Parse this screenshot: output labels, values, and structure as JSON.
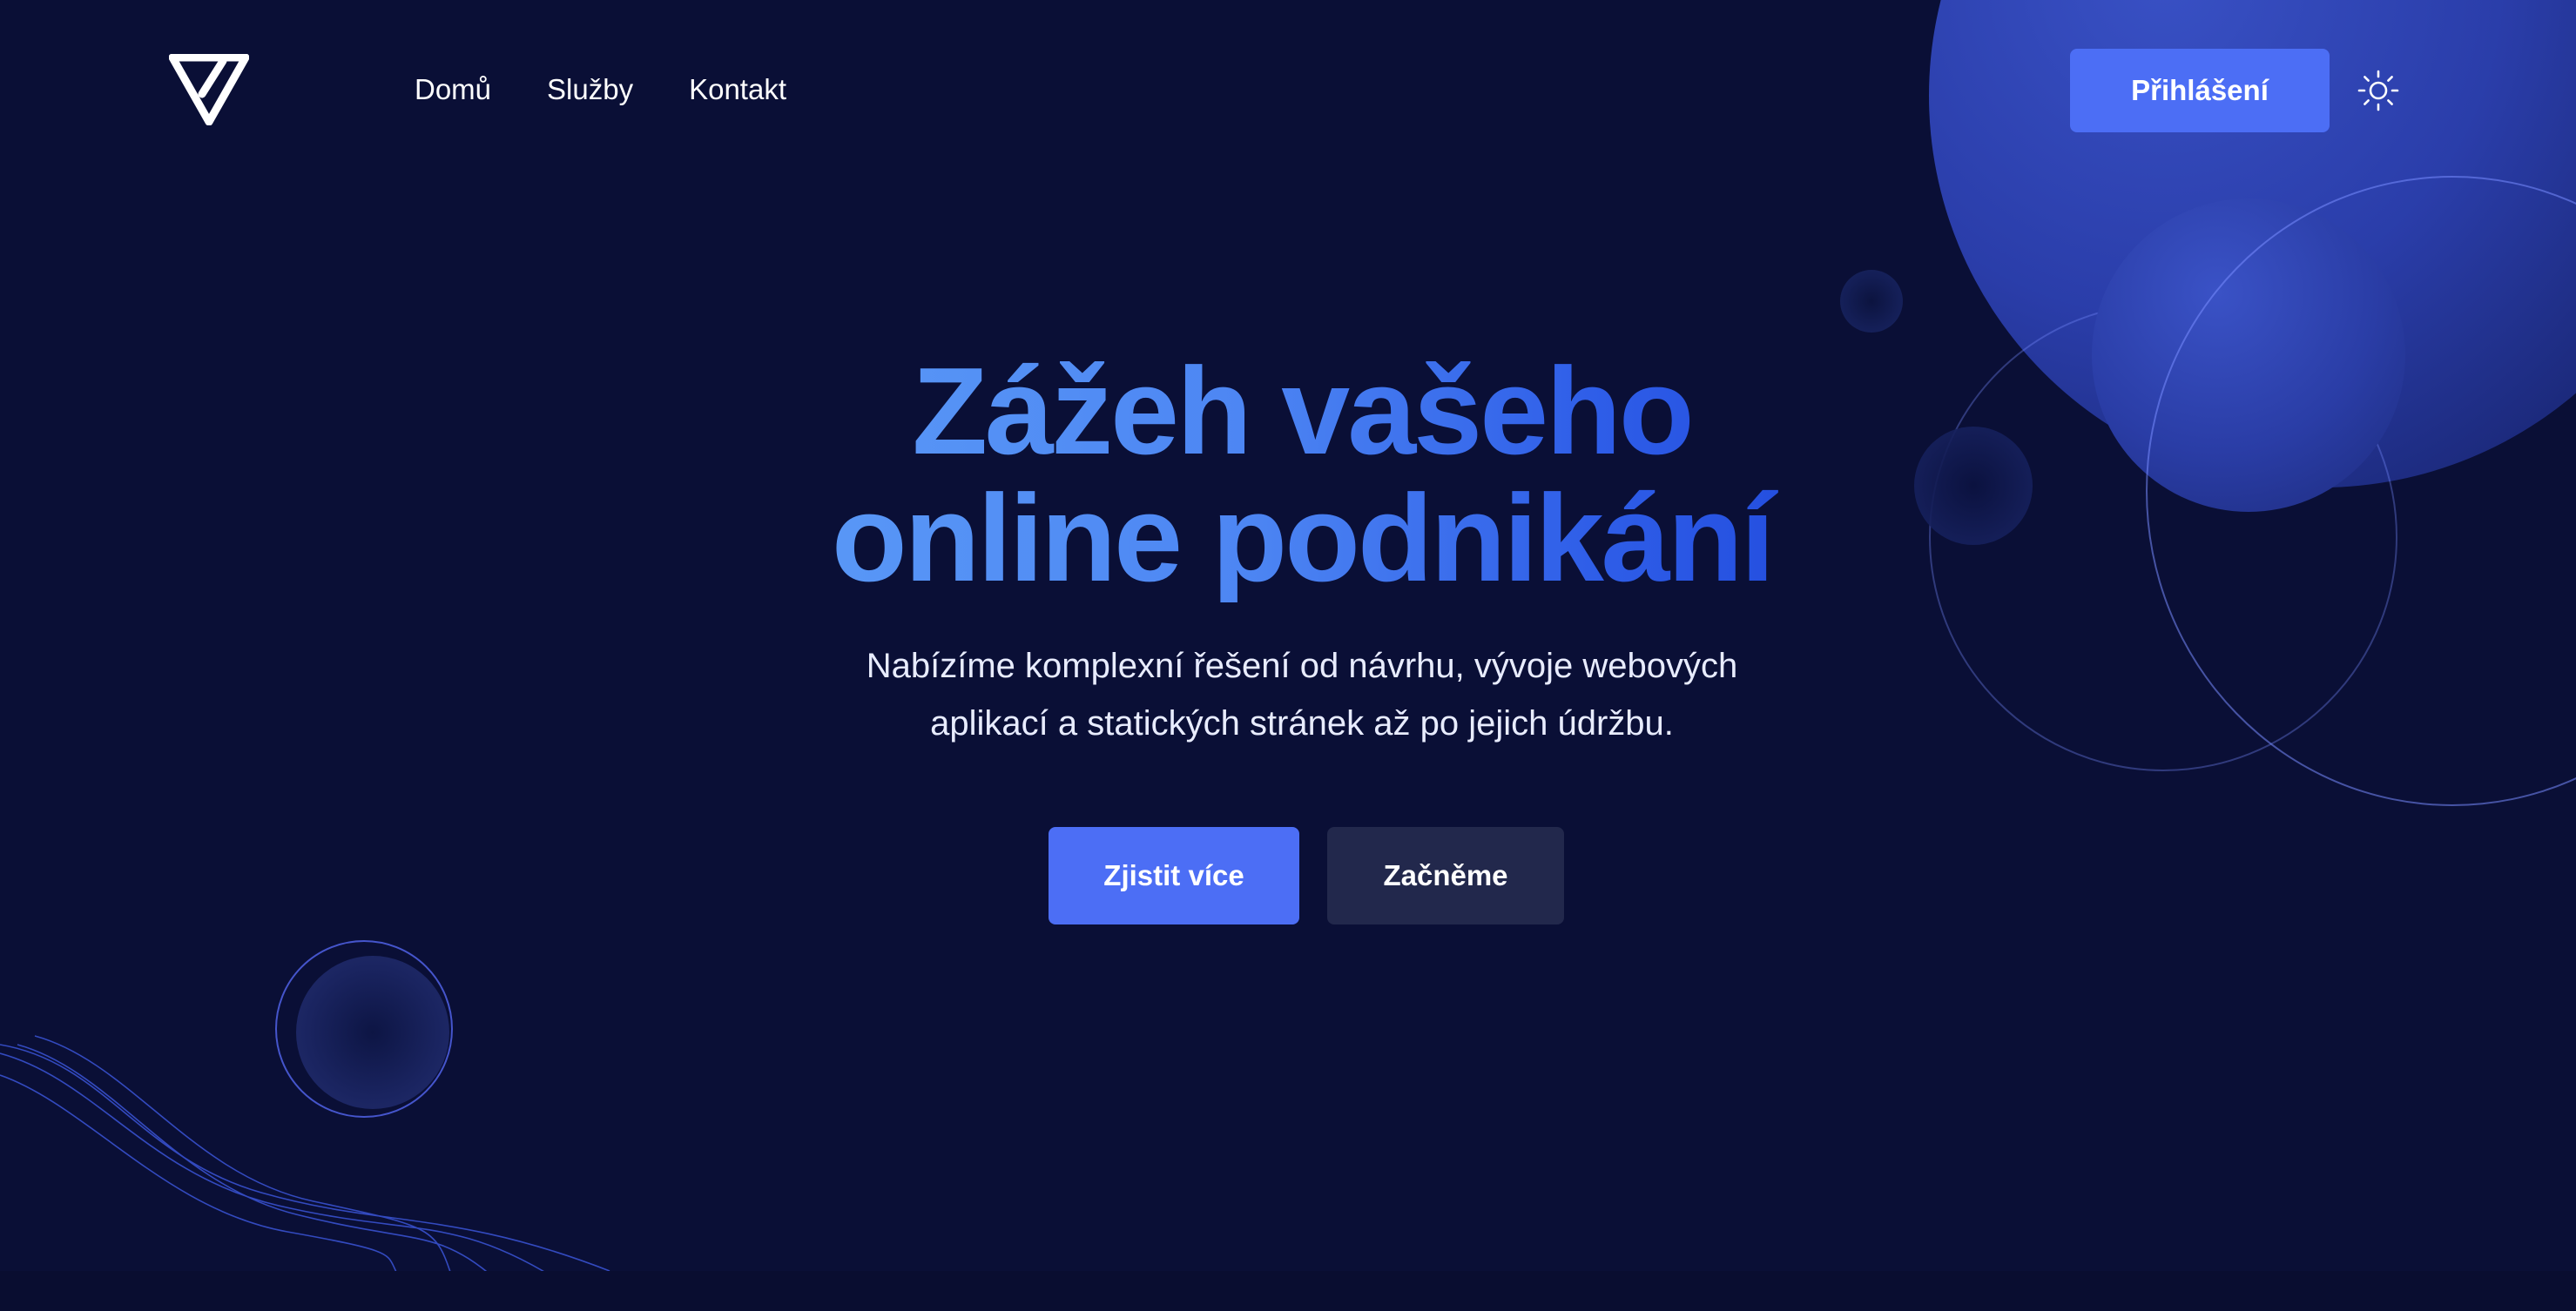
{
  "nav": {
    "items": [
      {
        "label": "Domů"
      },
      {
        "label": "Služby"
      },
      {
        "label": "Kontakt"
      }
    ],
    "login_label": "Přihlášení",
    "logo_icon": "triangle-v-logo-icon",
    "theme_icon": "sun-icon"
  },
  "hero": {
    "title_line1": "Zážeh vašeho",
    "title_line2": "online podnikání",
    "subtitle_line1": "Nabízíme komplexní řešení od návrhu, vývoje webových",
    "subtitle_line2": "aplikací a statických stránek až po jejich údržbu.",
    "primary_cta": "Zjistit více",
    "secondary_cta": "Začněme"
  },
  "colors": {
    "background": "#0a0f36",
    "accent": "#4c6ef5",
    "secondary_button": "#22284c",
    "title_gradient_start": "#5b9bf7",
    "title_gradient_end": "#1f48dc"
  }
}
